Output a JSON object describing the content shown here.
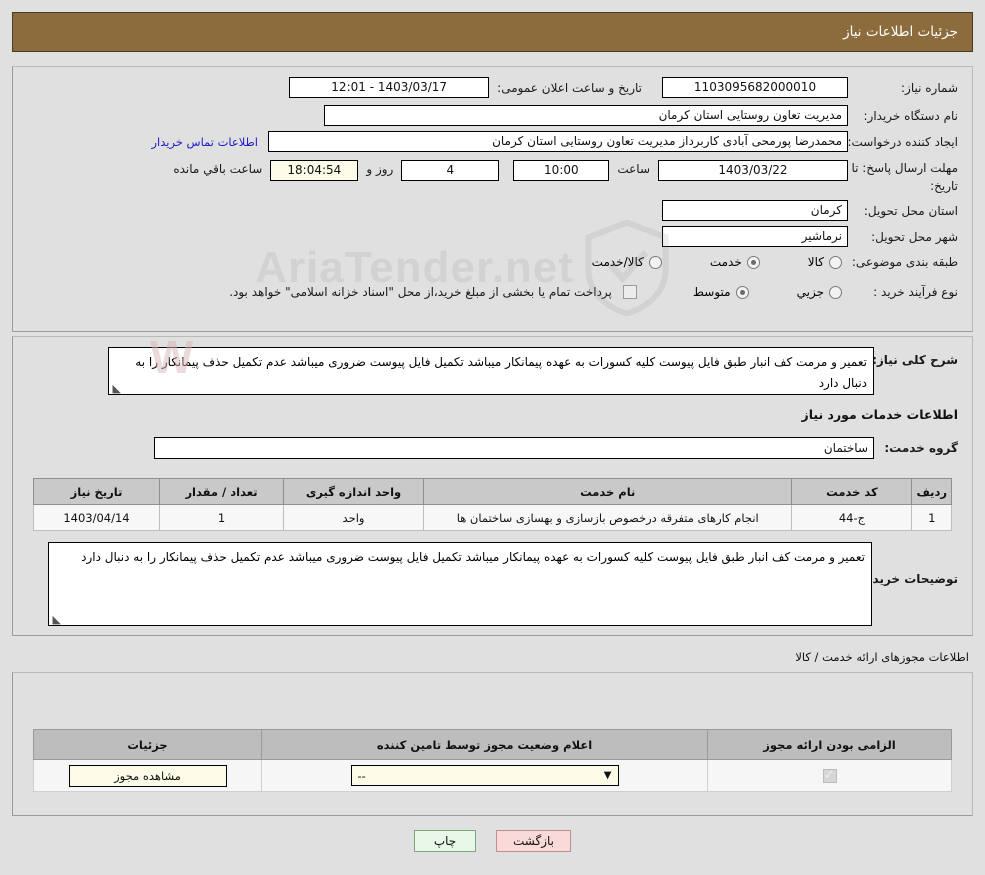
{
  "header": {
    "title": "جزئیات اطلاعات نیاز"
  },
  "colors": {
    "header_bar": "#8c6c3c",
    "page_bg": "#e0e0e0",
    "link": "#1b1bc8",
    "table_header": "#c9c9c9",
    "print_button": "#e9f7e9",
    "back_button": "#fadad8",
    "cream_field": "#fbfbe8"
  },
  "main": {
    "need_number_label": "شماره نیاز:",
    "need_number_value": "1103095682000010",
    "announce_label": "تاریخ و ساعت اعلان عمومی:",
    "announce_value": "1403/03/17 - 12:01",
    "buyer_org_label": "نام دستگاه خریدار:",
    "buyer_org_value": "مدیریت تعاون روستایی استان کرمان",
    "creator_label": "ایجاد کننده درخواست:",
    "creator_value": "محمدرضا پورمحی آبادی کاربرداز مدیریت تعاون روستایی استان کرمان",
    "contact_link": "اطلاعات تماس خریدار",
    "deadline_label": "مهلت ارسال پاسخ: تا تاریخ:",
    "deadline_date": "1403/03/22",
    "deadline_time_label": "ساعت",
    "deadline_time": "10:00",
    "days_value": "4",
    "days_unit": "روز و",
    "remaining_clock": "18:04:54",
    "remaining_suffix": "ساعت باقي مانده",
    "province_label": "استان محل تحویل:",
    "province_value": "کرمان",
    "city_label": "شهر محل تحویل:",
    "city_value": "نرماشیر",
    "category_label": "طبقه بندی موضوعی:",
    "category_options": [
      {
        "label": "کالا",
        "selected": false
      },
      {
        "label": "خدمت",
        "selected": true
      },
      {
        "label": "کالا/خدمت",
        "selected": false
      }
    ],
    "process_label": "نوع فرآیند خرید :",
    "process_options": [
      {
        "label": "جزیي",
        "selected": false
      },
      {
        "label": "متوسط",
        "selected": true
      }
    ],
    "treasury_checkbox_checked": false,
    "treasury_text": "پرداخت تمام یا بخشی از مبلغ خرید،از محل \"اسناد خزانه اسلامی\" خواهد بود."
  },
  "description": {
    "summary_label": "شرح کلی نیاز:",
    "summary_value": "تعمیر و مرمت کف انبار طبق فایل پیوست کلیه کسورات به عهده پیمانکار میباشد تکمیل فایل پیوست ضروری میباشد عدم تکمیل حذف پیمانکار را به دنبال دارد",
    "services_section_title": "اطلاعات خدمات مورد نیاز",
    "service_group_label": "گروه خدمت:",
    "service_group_value": "ساختمان",
    "table": {
      "headers": [
        "ردیف",
        "کد خدمت",
        "نام خدمت",
        "واحد اندازه گیری",
        "تعداد / مقدار",
        "تاریخ نیاز"
      ],
      "rows": [
        [
          "1",
          "ج-44",
          "انجام کارهای متفرقه درخصوص بازسازی و بهسازی ساختمان ها",
          "واحد",
          "1",
          "1403/04/14"
        ]
      ]
    },
    "buyer_notes_label": "توضیحات خریدار:",
    "buyer_notes_value": "تعمیر و مرمت کف انبار طبق فایل پیوست کلیه کسورات به عهده پیمانکار میباشد تکمیل فایل پیوست ضروری میباشد عدم تکمیل حذف پیمانکار را به دنبال دارد"
  },
  "permits": {
    "section_title": "اطلاعات مجوزهای ارائه خدمت / کالا",
    "headers": [
      "الزامی بودن ارائه مجوز",
      "اعلام وضعیت مجوز توسط تامین کننده",
      "جزئیات"
    ],
    "row": {
      "required_checked": true,
      "status_value": "--",
      "detail_button": "مشاهده مجوز"
    }
  },
  "footer": {
    "print_button": "چاپ",
    "back_button": "بازگشت"
  },
  "watermark": {
    "text": "AriaTender.net"
  }
}
